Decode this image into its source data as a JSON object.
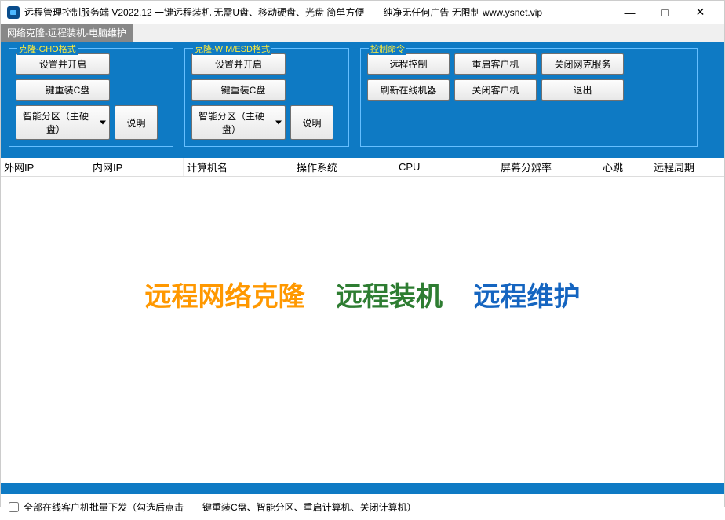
{
  "window": {
    "title": "远程管理控制服务端 V2022.12 一键远程装机 无需U盘、移动硬盘、光盘 简单方便　　纯净无任何广告 无限制 www.ysnet.vip"
  },
  "tab": {
    "active": "网络克隆-远程装机-电脑维护"
  },
  "groups": {
    "gho": {
      "legend": "克隆-GHO格式",
      "btn_set": "设置并开启",
      "btn_reinstall": "一键重装C盘",
      "btn_partition": "智能分区（主硬盘）",
      "btn_help": "说明"
    },
    "wim": {
      "legend": "克隆-WIM/ESD格式",
      "btn_set": "设置并开启",
      "btn_reinstall": "一键重装C盘",
      "btn_partition": "智能分区（主硬盘）",
      "btn_help": "说明"
    },
    "ctrl": {
      "legend": "控制命令",
      "btn_remote": "远程控制",
      "btn_restart": "重启客户机",
      "btn_closenet": "关闭网克服务",
      "btn_refresh": "刷新在线机器",
      "btn_shutdown": "关闭客户机",
      "btn_exit": "退出"
    }
  },
  "columns": {
    "wan_ip": "外网IP",
    "lan_ip": "内网IP",
    "computer_name": "计算机名",
    "os": "操作系统",
    "cpu": "CPU",
    "resolution": "屏幕分辨率",
    "heartbeat": "心跳",
    "remote_cycle": "远程周期"
  },
  "watermark": {
    "t1": "远程网络克隆",
    "t2": "远程装机",
    "t3": "远程维护"
  },
  "footer": {
    "checkbox_label": "全部在线客户机批量下发（勾选后点击　一键重装C盘、智能分区、重启计算机、关闭计算机）"
  }
}
